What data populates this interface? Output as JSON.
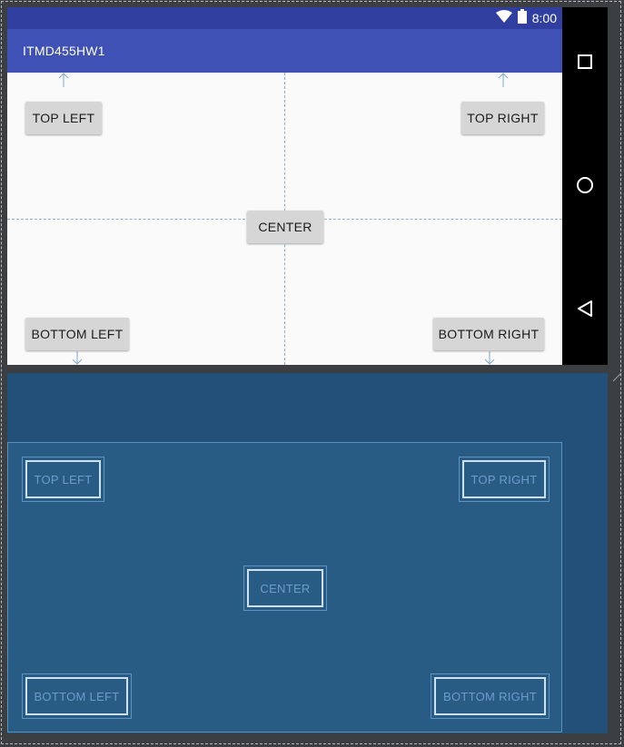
{
  "status_bar": {
    "time": "8:00",
    "icons": [
      "wifi-icon",
      "battery-icon"
    ]
  },
  "app_bar": {
    "title": "ITMD455HW1"
  },
  "buttons": {
    "top_left": "TOP LEFT",
    "top_right": "TOP RIGHT",
    "center": "CENTER",
    "bottom_left": "BOTTOM LEFT",
    "bottom_right": "BOTTOM RIGHT"
  },
  "nav_bar": {
    "icons": [
      "recents-icon",
      "home-icon",
      "back-icon"
    ]
  },
  "colors": {
    "status_bar": "#303f9f",
    "app_bar": "#3f51b5",
    "content_bg": "#fafafa",
    "blueprint_bg": "#235078",
    "blueprint_content": "#285c85"
  }
}
